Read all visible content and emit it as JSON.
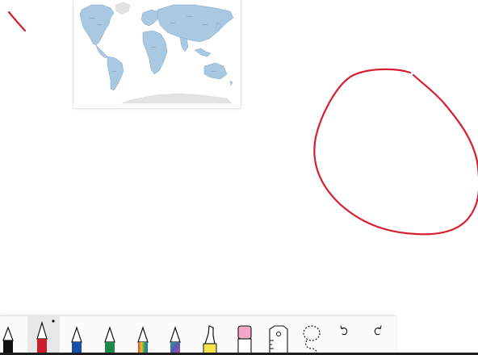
{
  "colors": {
    "ink_red": "#d5202f",
    "map_land": "#a9c9e3",
    "map_land_stroke": "#7fa6c7",
    "map_antarctica": "#e3e3e3",
    "pen_black": "#111111",
    "pen_red": "#c81d2b",
    "pen_blue": "#1a4fa8",
    "pen_green": "#1e8a4a",
    "highlighter_yellow": "#f5e54a",
    "eraser_pink": "#f4a7c4"
  },
  "canvas": {
    "map_image": {
      "caption": "",
      "icon": "world-map"
    },
    "ink_strokes": [
      {
        "name": "slash-stroke",
        "color": "#d5202f"
      },
      {
        "name": "circle-stroke",
        "color": "#d5202f"
      }
    ]
  },
  "toolbar": {
    "tools": [
      {
        "name": "ballpoint-pen-black",
        "icon": "pen-icon",
        "color": "#111111",
        "selected": false
      },
      {
        "name": "ballpoint-pen-red",
        "icon": "pen-icon",
        "color": "#c81d2b",
        "selected": true
      },
      {
        "name": "pen-blue",
        "icon": "pen-icon",
        "color": "#1a4fa8",
        "selected": false
      },
      {
        "name": "pen-green",
        "icon": "pen-icon",
        "color": "#1e8a4a",
        "selected": false
      },
      {
        "name": "pen-rainbow",
        "icon": "pen-icon",
        "color": "rainbow",
        "selected": false
      },
      {
        "name": "pen-galaxy",
        "icon": "pen-icon",
        "color": "galaxy",
        "selected": false
      },
      {
        "name": "highlighter-yellow",
        "icon": "highlighter-icon",
        "color": "#f5e54a",
        "selected": false
      },
      {
        "name": "eraser",
        "icon": "eraser-icon",
        "color": "#f4a7c4",
        "selected": false
      },
      {
        "name": "ruler",
        "icon": "ruler-icon",
        "selected": false
      },
      {
        "name": "lasso-select",
        "icon": "lasso-icon",
        "selected": false
      },
      {
        "name": "undo",
        "icon": "undo-icon",
        "selected": false
      },
      {
        "name": "redo",
        "icon": "redo-icon",
        "selected": false
      }
    ]
  }
}
